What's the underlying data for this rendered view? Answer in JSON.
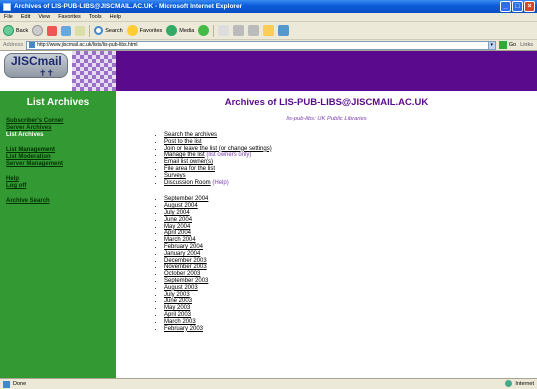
{
  "window": {
    "title": "Archives of LIS-PUB-LIBS@JISCMAIL.AC.UK - Microsoft Internet Explorer",
    "controls": {
      "minimize": "_",
      "maximize": "□",
      "close": "×"
    }
  },
  "menubar": [
    "File",
    "Edit",
    "View",
    "Favorites",
    "Tools",
    "Help"
  ],
  "toolbar": {
    "back": "Back",
    "search": "Search",
    "favorites": "Favorites",
    "media": "Media"
  },
  "address": {
    "label": "Address",
    "url": "http://www.jiscmail.ac.uk/lists/lis-pub-libs.html",
    "go": "Go",
    "links": "Links"
  },
  "logo": {
    "text": "JISCmail"
  },
  "sidebar": {
    "title": "List Archives",
    "groups": [
      {
        "items": [
          {
            "label": "Subscriber's Corner",
            "current": false
          },
          {
            "label": "Server Archives",
            "current": false
          },
          {
            "label": "List Archives",
            "current": true
          }
        ]
      },
      {
        "items": [
          {
            "label": "List Management",
            "current": false
          },
          {
            "label": "List Moderation",
            "current": false
          },
          {
            "label": "Server Management",
            "current": false
          }
        ]
      },
      {
        "items": [
          {
            "label": "Help",
            "current": false
          },
          {
            "label": "Log off",
            "current": false
          }
        ]
      },
      {
        "items": [
          {
            "label": "Archive Search",
            "current": false
          }
        ]
      }
    ]
  },
  "main": {
    "title": "Archives of LIS-PUB-LIBS@JISCMAIL.AC.UK",
    "subtitle": "lis-pub-libs: UK Public Libraries",
    "links": [
      {
        "label": "Search the archives",
        "hint": ""
      },
      {
        "label": "Post to the list",
        "hint": ""
      },
      {
        "label": "Join or leave the list (or change settings)",
        "hint": ""
      },
      {
        "label": "Manage the list",
        "hint": " (list owners only)"
      },
      {
        "label": "Email list owner(s)",
        "hint": ""
      },
      {
        "label": "File area for the list",
        "hint": ""
      },
      {
        "label": "Surveys",
        "hint": ""
      },
      {
        "label": "Discussion Room",
        "hint": " (Help)"
      }
    ],
    "months": [
      "September 2004",
      "August 2004",
      "July 2004",
      "June 2004",
      "May 2004",
      "April 2004",
      "March 2004",
      "February 2004",
      "January 2004",
      "December 2003",
      "November 2003",
      "October 2003",
      "September 2003",
      "August 2003",
      "July 2003",
      "June 2003",
      "May 2003",
      "April 2003",
      "March 2003",
      "February 2003"
    ]
  },
  "status": {
    "text": "Done",
    "zone": "Internet"
  },
  "colors": {
    "banner": "#5a0a8c",
    "sidebar": "#339933",
    "title_text": "#5a0a8c"
  }
}
